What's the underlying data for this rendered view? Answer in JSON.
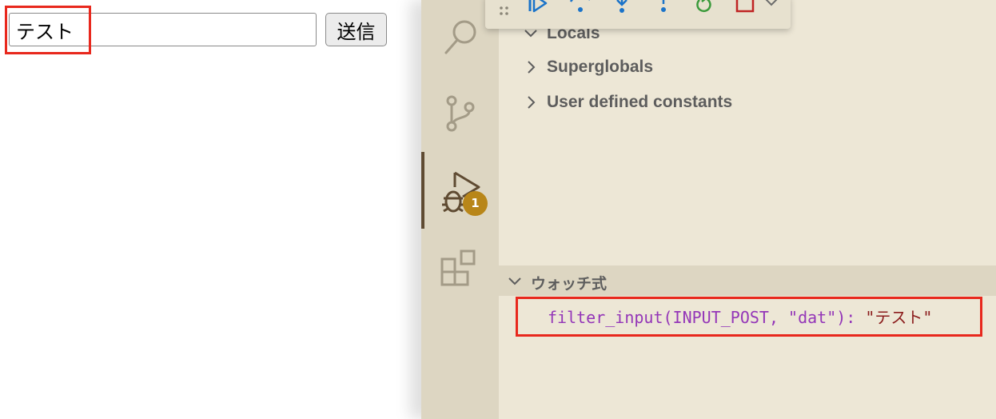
{
  "form": {
    "input_value": "テスト",
    "submit_label": "送信"
  },
  "activity_bar": {
    "items": [
      "search",
      "source-control",
      "run-and-debug",
      "extensions"
    ],
    "debug_badge": "1"
  },
  "variables": {
    "scopes": [
      {
        "label": "Locals",
        "state": "expanded"
      },
      {
        "label": "Superglobals",
        "state": "collapsed"
      },
      {
        "label": "User defined constants",
        "state": "collapsed"
      }
    ]
  },
  "watch": {
    "header": "ウォッチ式",
    "expressions": [
      {
        "expr": "filter_input(INPUT_POST, \"dat\"): ",
        "value": "\"テスト\""
      }
    ]
  },
  "debug_toolbar": {
    "icons": [
      "drag-handle",
      "continue",
      "step-over",
      "step-into",
      "step-out",
      "restart",
      "stop",
      "chevron-down"
    ]
  },
  "colors": {
    "highlight": "#e8281d",
    "badge": "#b88619",
    "watch_expr": "#9436b8",
    "watch_value": "#8b1c1c",
    "panel_bg": "#ede7d6",
    "activity_bg": "#ddd6c2"
  }
}
